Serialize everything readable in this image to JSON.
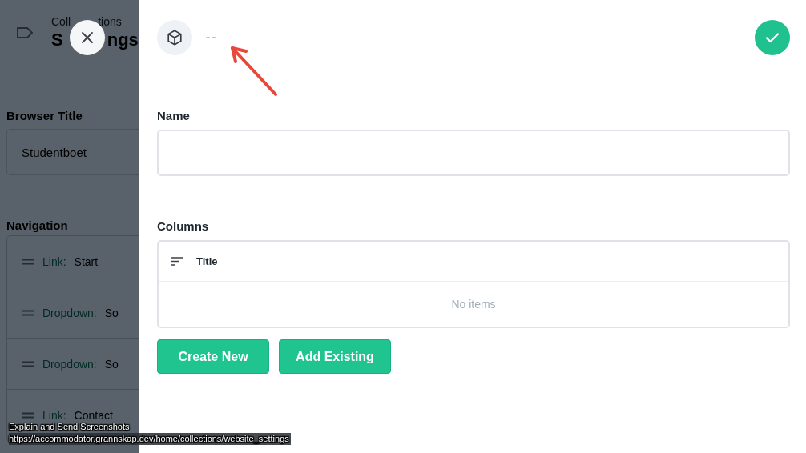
{
  "background_page": {
    "breadcrumb": [
      "Coll",
      "tions"
    ],
    "title": [
      "S",
      "ngs"
    ],
    "browser_title": {
      "label": "Browser Title",
      "value": "Studentboet"
    },
    "navigation": {
      "label": "Navigation",
      "items": [
        {
          "type": "Link:",
          "name": "Start"
        },
        {
          "type": "Dropdown:",
          "name": "So"
        },
        {
          "type": "Dropdown:",
          "name": "So"
        },
        {
          "type": "Link:",
          "name": "Contact"
        }
      ]
    }
  },
  "drawer": {
    "title": "--",
    "name_field": {
      "label": "Name"
    },
    "columns": {
      "label": "Columns",
      "header": "Title",
      "empty_text": "No items"
    },
    "buttons": [
      "Create New",
      "Add Existing"
    ]
  },
  "capture_caption": {
    "title": "Explain and Send Screenshots",
    "url": "https://accommodator.grannskap.dev/home/collections/website_settings"
  }
}
